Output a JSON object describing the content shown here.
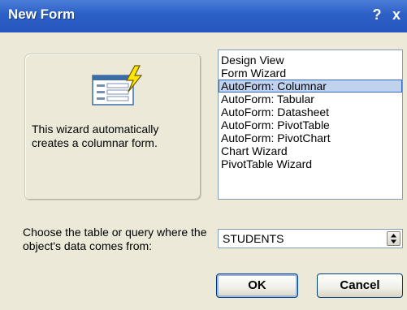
{
  "window": {
    "title": "New Form",
    "help_label": "?",
    "close_label": "x"
  },
  "preview": {
    "icon": "form-wizard-icon",
    "description": "This wizard automatically creates a columnar form."
  },
  "list": {
    "items": [
      "Design View",
      "Form Wizard",
      "AutoForm: Columnar",
      "AutoForm: Tabular",
      "AutoForm: Datasheet",
      "AutoForm: PivotTable",
      "AutoForm: PivotChart",
      "Chart Wizard",
      "PivotTable Wizard"
    ],
    "selected_index": 2
  },
  "source": {
    "label": "Choose the table or query where the object's data comes from:",
    "value": "STUDENTS"
  },
  "buttons": {
    "ok_label": "OK",
    "cancel_label": "Cancel"
  },
  "colors": {
    "title_bar": "#2C5FC6",
    "selection": "#C1D2EE",
    "dialog_bg": "#ECE9D8"
  }
}
